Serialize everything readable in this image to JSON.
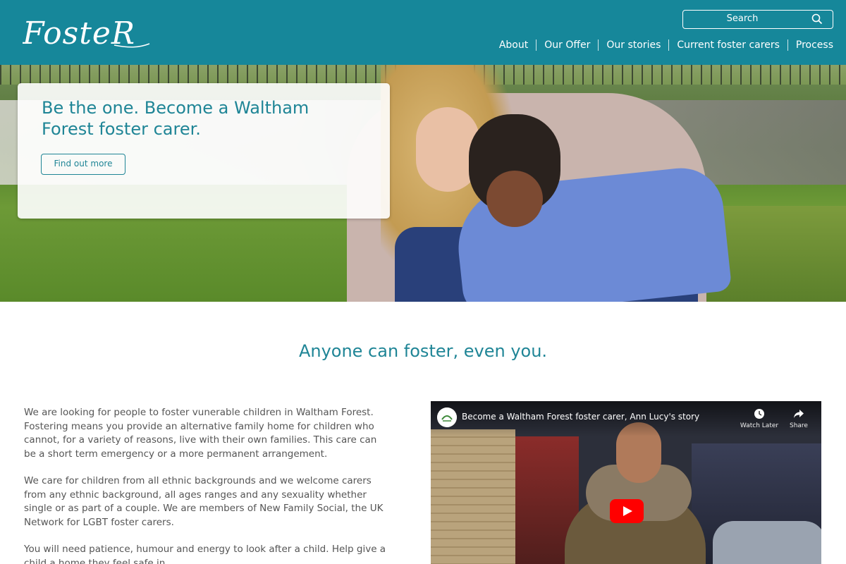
{
  "header": {
    "logo_text": "FosteR",
    "search_label": "Search",
    "nav": [
      "About",
      "Our Offer",
      "Our stories",
      "Current foster carers",
      "Process"
    ],
    "brand_color": "#16879a"
  },
  "hero": {
    "title": "Be the one. Become a Waltham Forest foster carer.",
    "button_label": "Find out more"
  },
  "main": {
    "heading": "Anyone can foster, even you.",
    "paragraphs": [
      "We are looking for people to foster vunerable children in Waltham Forest. Fostering means you provide an alternative family home for children who cannot, for a variety of reasons, live with their own  families. This care can be a short term emergency or a more permanent arrangement.",
      "We care for children from all ethnic backgrounds and we welcome carers from any ethnic background, all ages ranges and any sexuality whether single or as part of a couple. We are members of New Family Social, the UK Network for LGBT foster carers.",
      "You will need patience, humour and energy to look after a child. Help give a child a home they feel safe in."
    ]
  },
  "video": {
    "title": "Become a Waltham Forest foster carer, Ann Lucy's story",
    "watch_later": "Watch Later",
    "share": "Share",
    "icons": [
      "clock-icon",
      "share-arrow-icon",
      "youtube-play-icon"
    ]
  }
}
